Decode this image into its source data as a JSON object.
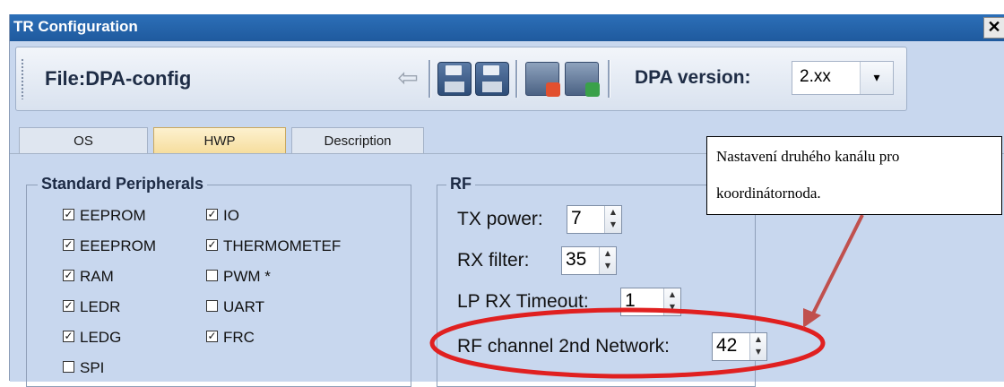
{
  "window": {
    "title": "TR Configuration",
    "close_glyph": "✕"
  },
  "toolbar": {
    "file_label": "File:DPA-config",
    "icons": [
      "back-arrow-icon",
      "save-icon",
      "save-as-icon",
      "download-icon",
      "upload-icon"
    ],
    "dpa_version_label": "DPA version:",
    "dpa_version_value": "2.xx",
    "dropdown_glyph": "▾"
  },
  "tabs": [
    "OS",
    "HWP",
    "Description"
  ],
  "active_tab": "HWP",
  "standard_peripherals": {
    "title": "Standard Peripherals",
    "items": [
      {
        "label": "EEPROM",
        "checked": true
      },
      {
        "label": "EEEPROM",
        "checked": true
      },
      {
        "label": "RAM",
        "checked": true
      },
      {
        "label": "LEDR",
        "checked": true
      },
      {
        "label": "LEDG",
        "checked": true
      },
      {
        "label": "SPI",
        "checked": false
      },
      {
        "label": "IO",
        "checked": true
      },
      {
        "label": "THERMOMETEF",
        "checked": true
      },
      {
        "label": "PWM *",
        "checked": false
      },
      {
        "label": "UART",
        "checked": false
      },
      {
        "label": "FRC",
        "checked": true
      }
    ]
  },
  "rf": {
    "title": "RF",
    "tx_power_label": "TX power:",
    "tx_power_value": "7",
    "rx_filter_label": "RX filter:",
    "rx_filter_value": "35",
    "lp_rx_timeout_label": "LP RX Timeout:",
    "lp_rx_timeout_value": "1",
    "rf_channel_label": "RF channel 2nd Network:",
    "rf_channel_value": "42"
  },
  "annotation": {
    "line1": "Nastavení druhého kanálu pro",
    "line2": "koordinátornoda.",
    "arrow_color": "#c0504d",
    "ellipse_color": "#e02020"
  },
  "colors": {
    "titlebar": "#1f5a9e",
    "panel": "#c8d7ee",
    "active_tab": "#f6dd9c"
  }
}
